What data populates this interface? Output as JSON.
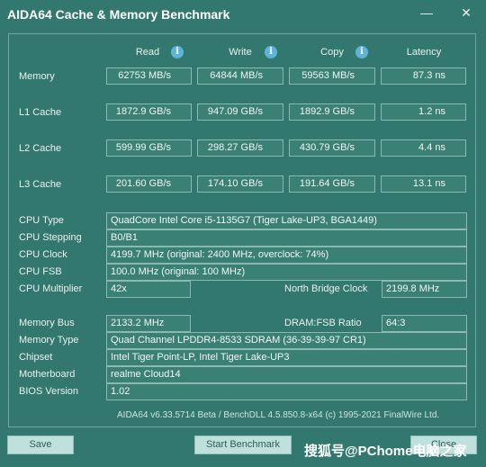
{
  "window": {
    "title": "AIDA64 Cache & Memory Benchmark"
  },
  "columns": {
    "read": "Read",
    "write": "Write",
    "copy": "Copy",
    "latency": "Latency"
  },
  "rows": [
    {
      "label": "Memory",
      "read": "62753 MB/s",
      "write": "64844 MB/s",
      "copy": "59563 MB/s",
      "latency": "87.3 ns"
    },
    {
      "label": "L1 Cache",
      "read": "1872.9 GB/s",
      "write": "947.09 GB/s",
      "copy": "1892.9 GB/s",
      "latency": "1.2 ns"
    },
    {
      "label": "L2 Cache",
      "read": "599.99 GB/s",
      "write": "298.27 GB/s",
      "copy": "430.79 GB/s",
      "latency": "4.4 ns"
    },
    {
      "label": "L3 Cache",
      "read": "201.60 GB/s",
      "write": "174.10 GB/s",
      "copy": "191.64 GB/s",
      "latency": "13.1 ns"
    }
  ],
  "cpu": {
    "type_label": "CPU Type",
    "type_value": "QuadCore Intel Core i5-1135G7  (Tiger Lake-UP3, BGA1449)",
    "stepping_label": "CPU Stepping",
    "stepping_value": "B0/B1",
    "clock_label": "CPU Clock",
    "clock_value": "4199.7 MHz  (original: 2400 MHz, overclock: 74%)",
    "fsb_label": "CPU FSB",
    "fsb_value": "100.0 MHz  (original: 100 MHz)",
    "multiplier_label": "CPU Multiplier",
    "multiplier_value": "42x",
    "nb_clock_label": "North Bridge Clock",
    "nb_clock_value": "2199.8 MHz"
  },
  "memory": {
    "bus_label": "Memory Bus",
    "bus_value": "2133.2 MHz",
    "ratio_label": "DRAM:FSB Ratio",
    "ratio_value": "64:3",
    "type_label": "Memory Type",
    "type_value": "Quad Channel LPDDR4-8533 SDRAM  (36-39-39-97 CR1)",
    "chipset_label": "Chipset",
    "chipset_value": "Intel Tiger Point-LP, Intel Tiger Lake-UP3",
    "motherboard_label": "Motherboard",
    "motherboard_value": "realme Cloud14",
    "bios_label": "BIOS Version",
    "bios_value": "1.02"
  },
  "footer": {
    "text": "AIDA64 v6.33.5714 Beta / BenchDLL 4.5.850.8-x64  (c) 1995-2021 FinalWire Ltd."
  },
  "buttons": {
    "save": "Save",
    "start": "Start Benchmark",
    "close": "Close"
  },
  "watermark": "搜狐号@PChome电脑之家"
}
